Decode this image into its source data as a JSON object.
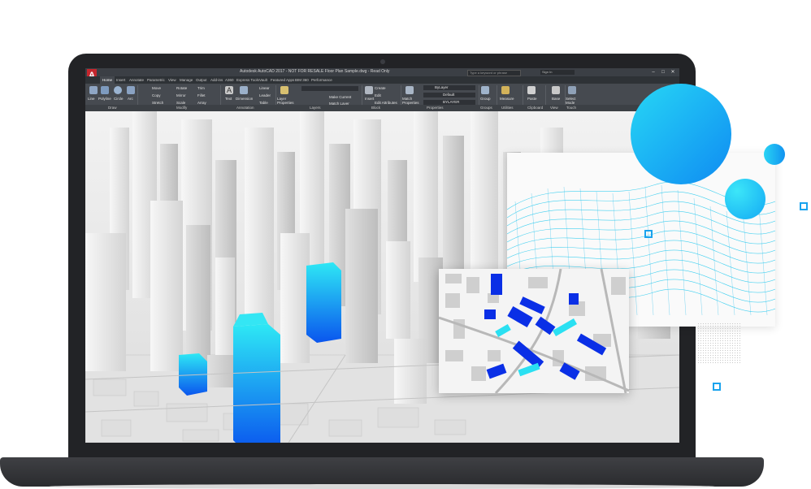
{
  "app": {
    "title": "Autodesk AutoCAD 2017 - NOT FOR RESALE   Floor Plan Sample.dwg - Read Only",
    "logo": "A",
    "search_placeholder": "Type a keyword or phrase",
    "user": "Sign In"
  },
  "tabs": [
    "Home",
    "Insert",
    "Annotate",
    "Parametric",
    "View",
    "Manage",
    "Output",
    "Add-ins",
    "A360",
    "Express Tools",
    "Vault",
    "Featured Apps",
    "BIM 360",
    "Performance"
  ],
  "ribbon": {
    "draw_buttons": [
      "Line",
      "Polyline",
      "Circle",
      "Arc"
    ],
    "modify_buttons": [
      "Move",
      "Rotate",
      "Trim",
      "Copy",
      "Mirror",
      "Fillet",
      "Stretch",
      "Scale",
      "Array"
    ],
    "annotation_buttons": [
      "Text",
      "Dimension",
      "Linear",
      "Leader",
      "Table"
    ],
    "layers_buttons": [
      "Layer Properties",
      "Make Current",
      "Match Layer"
    ],
    "block_buttons": [
      "Insert",
      "Create",
      "Edit",
      "Edit Attributes"
    ],
    "properties_buttons": [
      "Match Properties",
      "ByLayer",
      "Default",
      "BYLAYER"
    ],
    "groups_buttons": [
      "Group"
    ],
    "utilities_buttons": [
      "Measure"
    ],
    "clipboard_buttons": [
      "Paste"
    ],
    "view_buttons": [
      "Base"
    ],
    "touch_buttons": [
      "Select Mode"
    ],
    "panels": [
      "Draw",
      "Modify",
      "Annotation",
      "Layers",
      "Block",
      "Properties",
      "Groups",
      "Utilities",
      "Clipboard",
      "View",
      "Touch"
    ]
  },
  "icons": {
    "logo": "autocad-logo-icon",
    "minimize": "minimize-icon",
    "maximize": "maximize-icon",
    "close": "close-icon"
  },
  "colors": {
    "accent_cyan": "#21d0f3",
    "accent_blue": "#0a4ef0",
    "autocad_red": "#c5262d"
  }
}
